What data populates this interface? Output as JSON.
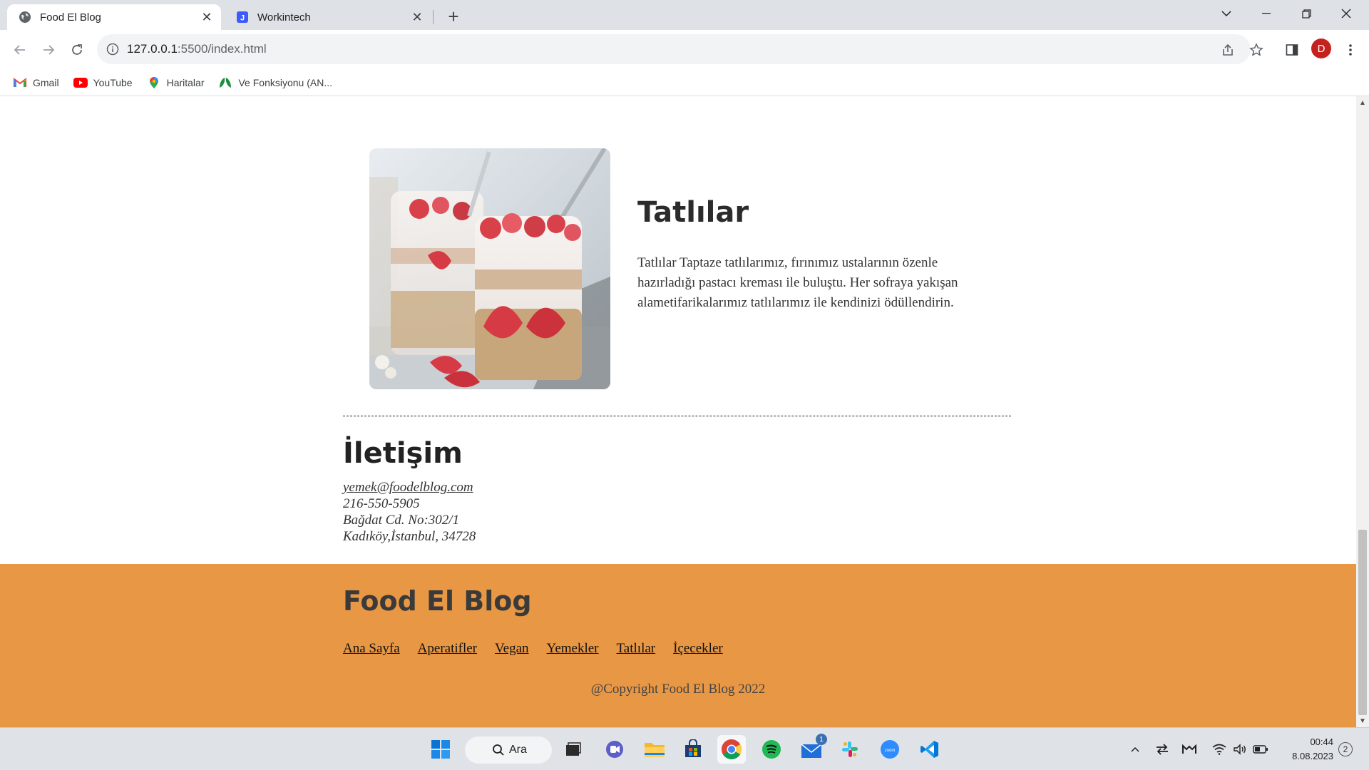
{
  "browser": {
    "tabs": [
      {
        "title": "Food El Blog",
        "active": true
      },
      {
        "title": "Workintech",
        "active": false
      }
    ],
    "url_host": "127.0.0.1",
    "url_rest": ":5500/index.html",
    "profile_initial": "D",
    "bookmarks": [
      {
        "label": "Gmail",
        "icon": "gmail-icon"
      },
      {
        "label": "YouTube",
        "icon": "youtube-icon"
      },
      {
        "label": "Haritalar",
        "icon": "maps-icon"
      },
      {
        "label": "Ve Fonksiyonu (AN...",
        "icon": "leaf-icon"
      }
    ]
  },
  "page": {
    "section": {
      "title": "Tatlılar",
      "text": "Tatlılar Taptaze tatlılarımız, fırınımız ustalarının özenle hazırladığı pastacı kreması ile buluştu. Her sofraya yakışan alametifarikalarımız tatlılarımız ile kendinizi ödüllendirin.",
      "image": "strawberry-parfait-jars-photo"
    },
    "contact": {
      "title": "İletişim",
      "email": "yemek@foodelblog.com",
      "phone": "216-550-5905",
      "address1": "Bağdat Cd. No:302/1",
      "address2": "Kadıköy,İstanbul, 34728"
    },
    "footer": {
      "brand": "Food El Blog",
      "nav": [
        "Ana Sayfa",
        "Aperatifler",
        "Vegan",
        "Yemekler",
        "Tatlılar",
        "İçecekler"
      ],
      "copyright": "@Copyright Food El Blog 2022",
      "background": "#e89744"
    }
  },
  "taskbar": {
    "search_label": "Ara",
    "mail_badge": "1",
    "time": "00:44",
    "date": "8.08.2023",
    "notifications": "2"
  }
}
